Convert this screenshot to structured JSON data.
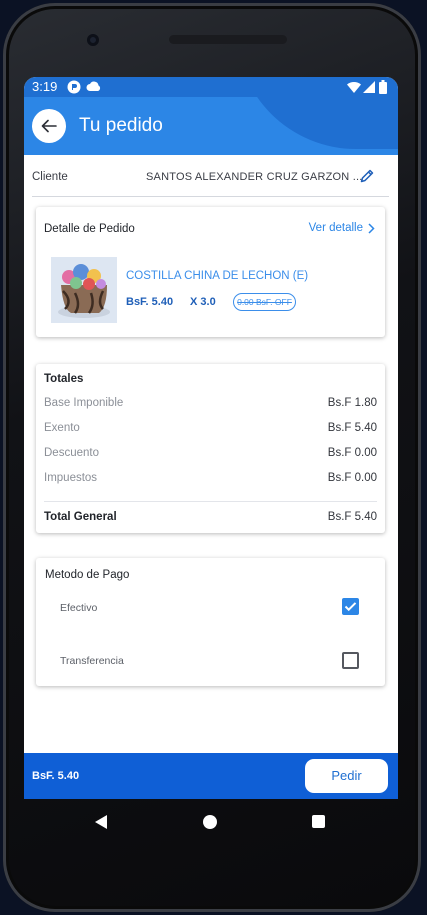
{
  "status_bar": {
    "time": "3:19",
    "icons": [
      "app-notification-icon",
      "cloud-icon",
      "wifi-icon",
      "signal-icon",
      "battery-icon"
    ]
  },
  "header": {
    "title": "Tu pedido",
    "back_icon": "arrow-left-icon"
  },
  "client": {
    "label": "Cliente",
    "value": "SANTOS ALEXANDER CRUZ GARZON ...",
    "edit_icon": "pencil-icon"
  },
  "order_detail": {
    "heading": "Detalle de Pedido",
    "link_label": "Ver detalle",
    "link_icon": "chevron-right-icon",
    "product": {
      "name": "COSTILLA CHINA DE LECHON (E)",
      "price": "BsF. 5.40",
      "quantity": "X 3.0",
      "discount": "0.00 BsF. OFF"
    }
  },
  "totals": {
    "heading": "Totales",
    "rows": [
      {
        "label": "Base Imponible",
        "value": "Bs.F 1.80"
      },
      {
        "label": "Exento",
        "value": "Bs.F 5.40"
      },
      {
        "label": "Descuento",
        "value": "Bs.F 0.00"
      },
      {
        "label": "Impuestos",
        "value": "Bs.F 0.00"
      }
    ],
    "total_label": "Total General",
    "total_value": "Bs.F 5.40"
  },
  "payment": {
    "heading": "Metodo de Pago",
    "options": [
      {
        "label": "Efectivo",
        "checked": true
      },
      {
        "label": "Transferencia",
        "checked": false
      }
    ]
  },
  "bottom_bar": {
    "total": "BsF. 5.40",
    "button_label": "Pedir"
  },
  "colors": {
    "primary": "#2c86e6",
    "primary_dark": "#1f6fd1",
    "bottom_bar": "#0f5fd6",
    "price_text": "#1f5fb8"
  }
}
